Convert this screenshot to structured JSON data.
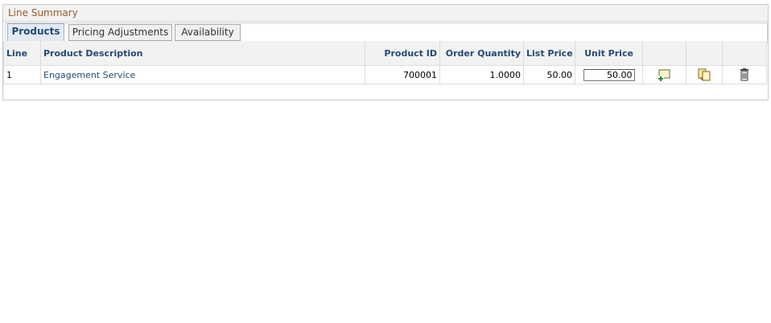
{
  "panel": {
    "title": "Line Summary"
  },
  "tabs": [
    {
      "label": "Products",
      "active": true
    },
    {
      "label": "Pricing Adjustments",
      "active": false
    },
    {
      "label": "Availability",
      "active": false
    }
  ],
  "table": {
    "columns": [
      "Line",
      "Product Description",
      "Product ID",
      "Order Quantity",
      "List Price",
      "Unit Price",
      "",
      "",
      ""
    ],
    "rows": [
      {
        "line": "1",
        "description": "Engagement Service",
        "product_id": "700001",
        "order_quantity": "1.0000",
        "list_price": "50.00",
        "unit_price": "50.00"
      }
    ],
    "row_actions": [
      "add-row-icon",
      "copy-row-icon",
      "delete-row-icon"
    ]
  },
  "colors": {
    "header_text": "#244a75",
    "panel_title": "#9a5b2a",
    "active_tab_bg": "#e2eaf3"
  }
}
